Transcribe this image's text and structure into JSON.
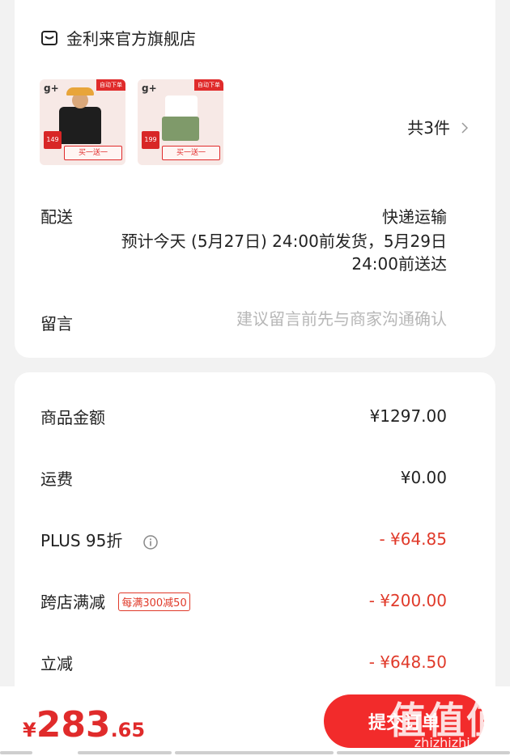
{
  "store": {
    "icon": "store-icon",
    "name": "金利来官方旗舰店",
    "item_count": "共3件",
    "products": [
      {
        "brand": "g+",
        "tag": "自动下单",
        "price": "149",
        "banner": "买一送一"
      },
      {
        "brand": "g+",
        "tag": "自动下单",
        "price": "199",
        "banner": "买一送一"
      }
    ]
  },
  "delivery": {
    "label": "配送",
    "method": "快递运输",
    "estimate": "预计今天 (5月27日) 24:00前发货，5月29日24:00前送达"
  },
  "remark": {
    "label": "留言",
    "placeholder": "建议留言前先与商家沟通确认"
  },
  "price_details": {
    "goods_amount": {
      "label": "商品金额",
      "value": "¥1297.00"
    },
    "shipping": {
      "label": "运费",
      "value": "¥0.00"
    },
    "plus": {
      "label": "PLUS 95折",
      "value": "- ¥64.85"
    },
    "cross_store": {
      "label": "跨店满减",
      "badge": "每满300减50",
      "value": "- ¥200.00"
    },
    "instant": {
      "label": "立减",
      "value": "- ¥648.50"
    }
  },
  "footer": {
    "currency": "¥",
    "total_integer": "283",
    "total_decimal": ".65",
    "submit_label": "提交订单"
  },
  "watermark": {
    "glyphs": "值值值",
    "url": "zhizhizhi.com"
  },
  "colors": {
    "accent": "#e02b2b",
    "discount": "#e03a2a",
    "button": "#f22b2b",
    "background": "#f2f2f2"
  }
}
